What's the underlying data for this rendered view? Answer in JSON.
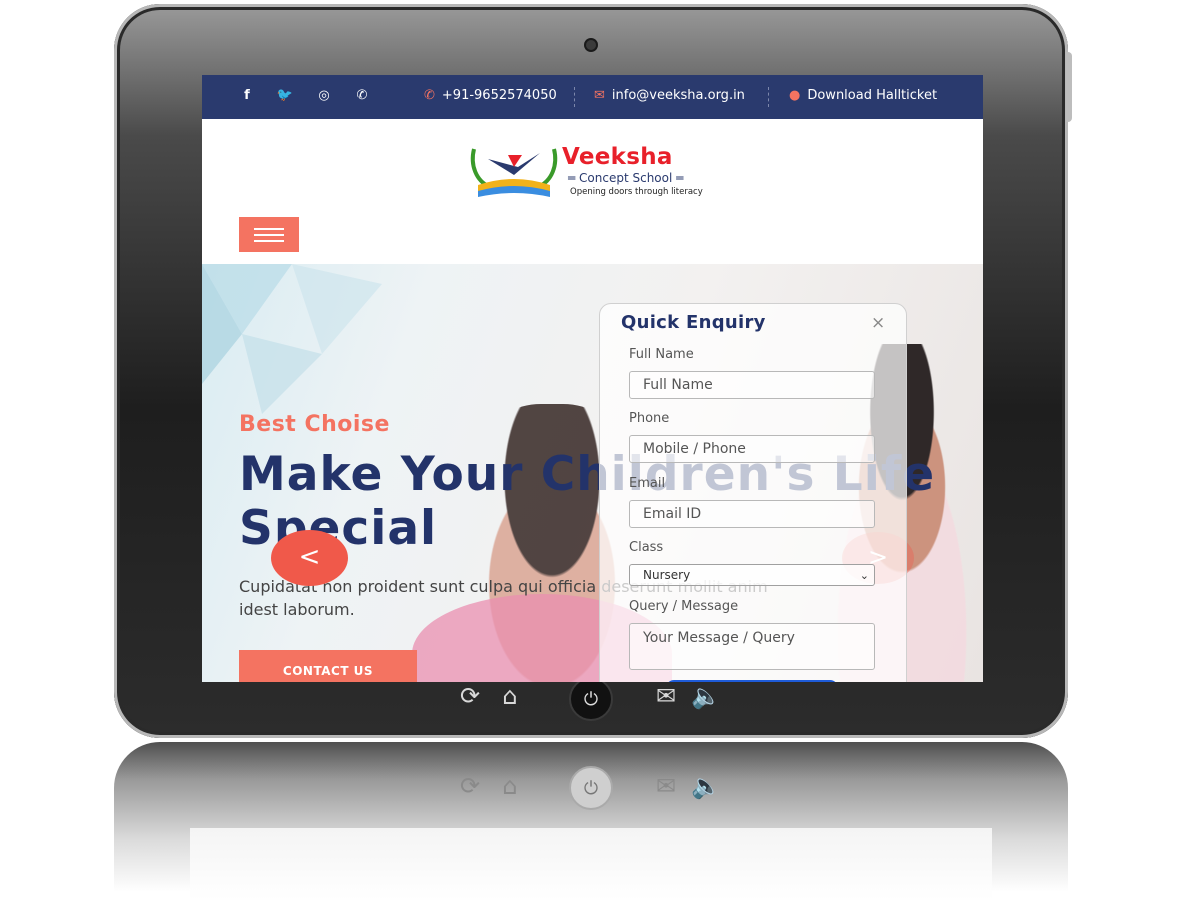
{
  "topbar": {
    "social": [
      {
        "icon": "facebook-icon",
        "glyph": "f"
      },
      {
        "icon": "twitter-icon",
        "glyph": "🐦"
      },
      {
        "icon": "instagram-icon",
        "glyph": "◎"
      },
      {
        "icon": "whatsapp-icon",
        "glyph": "✆"
      }
    ],
    "phone": "+91-9652574050",
    "email": "info@veeksha.org.in",
    "download": "Download Hallticket"
  },
  "header": {
    "logo_name": "Veeksha",
    "logo_sub": "═ Concept School ═",
    "logo_tagline": "Opening doors through literacy"
  },
  "hero": {
    "pre_title": "Best Choise",
    "title": "Make Your Children's Life Special",
    "text": "Cupidatat non proident sunt culpa qui officia deserunt mollit anim idest laborum.",
    "button": "CONTACT US",
    "prev_arrow": "<",
    "next_arrow": ">"
  },
  "enquiry": {
    "title": "Quick Enquiry",
    "close": "×",
    "fields": {
      "name_label": "Full Name",
      "name_placeholder": "Full Name",
      "phone_label": "Phone",
      "phone_placeholder": "Mobile / Phone",
      "email_label": "Email",
      "email_placeholder": "Email ID",
      "class_label": "Class",
      "class_value": "Nursery",
      "query_label": "Query / Message",
      "query_placeholder": "Your Message / Query"
    }
  },
  "colors": {
    "topbar": "#2a3a6e",
    "accent": "#f47361",
    "title": "#23336a"
  }
}
